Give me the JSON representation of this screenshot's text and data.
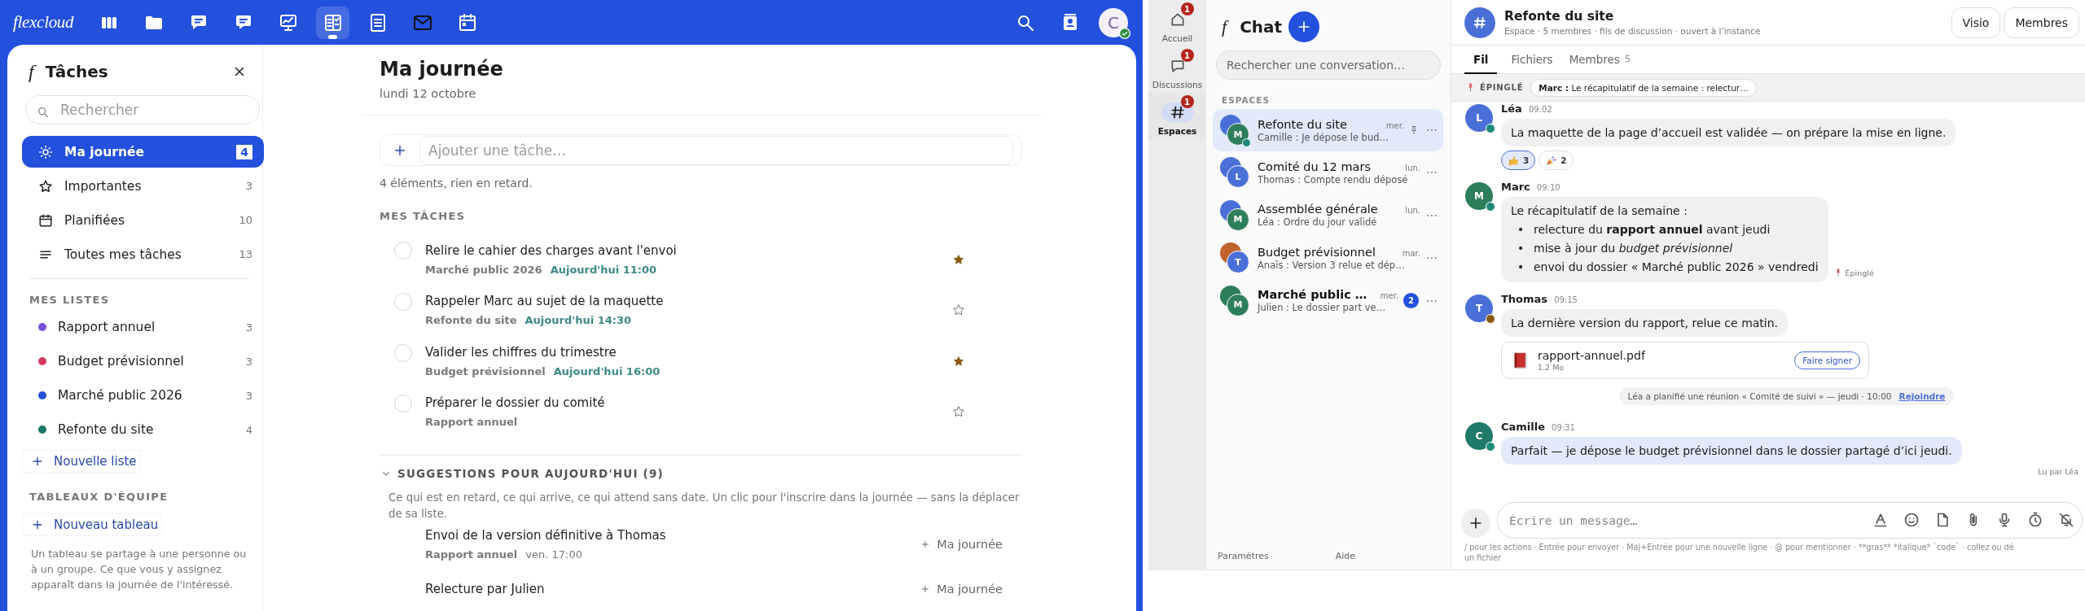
{
  "tasks_app": {
    "top_bar": {
      "logo": "flexcloud",
      "apps": [
        {
          "selected": false
        },
        {
          "selected": false
        },
        {
          "selected": false
        },
        {
          "selected": false
        },
        {
          "selected": false
        },
        {
          "selected": true
        },
        {
          "selected": false
        },
        {
          "selected": false
        },
        {
          "selected": false
        }
      ],
      "avatar": {
        "initial": "C",
        "online": true
      }
    },
    "sidebar": {
      "mark": "f",
      "title": "Tâches",
      "search_placeholder": "Rechercher",
      "views": [
        {
          "kind": "sun",
          "label": "Ma journée",
          "count": "4",
          "selected": true
        },
        {
          "kind": "star",
          "label": "Importantes",
          "count": "3",
          "selected": false
        },
        {
          "kind": "calendar",
          "label": "Planifiées",
          "count": "10",
          "selected": false
        },
        {
          "kind": "list",
          "label": "Toutes mes tâches",
          "count": "13",
          "selected": false
        }
      ],
      "lists_heading": "MES LISTES",
      "lists": [
        {
          "label": "Rapport annuel",
          "count": "3",
          "color": "#7b4fd9"
        },
        {
          "label": "Budget prévisionnel",
          "count": "3",
          "color": "#d6395e"
        },
        {
          "label": "Marché public 2026",
          "count": "3",
          "color": "#2350dd"
        },
        {
          "label": "Refonte du site",
          "count": "4",
          "color": "#1b7a6a"
        }
      ],
      "new_list": "Nouvelle liste",
      "boards_heading": "TABLEAUX D'ÉQUIPE",
      "new_board": "Nouveau tableau",
      "boards_note": "Un tableau se partage à une personne ou à un groupe. Ce que vous y assignez apparaît dans la journée de l'intéressé."
    },
    "main": {
      "title": "Ma journée",
      "date": "lundi 12 octobre",
      "add_placeholder": "Ajouter une tâche…",
      "summary": "4 éléments, rien en retard.",
      "section": "MES TÂCHES",
      "tasks": [
        {
          "title": "Relire le cahier des charges avant l'envoi",
          "list": "Marché public 2026",
          "due": "Aujourd'hui 11:00",
          "starred": true,
          "done": false
        },
        {
          "title": "Rappeler Marc au sujet de la maquette",
          "list": "Refonte du site",
          "due": "Aujourd'hui 14:30",
          "starred": false,
          "done": false
        },
        {
          "title": "Valider les chiffres du trimestre",
          "list": "Budget prévisionnel",
          "due": "Aujourd'hui 16:00",
          "starred": true,
          "done": false
        },
        {
          "title": "Préparer le dossier du comité",
          "list": "Rapport annuel",
          "starred": false,
          "done": false
        }
      ],
      "suggestions": {
        "heading": "SUGGESTIONS POUR AUJOURD'HUI (9)",
        "expanded": true,
        "description": "Ce qui est en retard, ce qui arrive, ce qui attend sans date. Un clic pour l'inscrire dans la journée — sans la déplacer de sa liste.",
        "items": [
          {
            "title": "Envoi de la version définitive à Thomas",
            "list": "Rapport annuel",
            "due": "ven. 17:00",
            "action": "Ma journée"
          },
          {
            "title": "Relecture par Julien",
            "action": "Ma journée"
          }
        ]
      }
    }
  },
  "chat_app": {
    "rail": [
      {
        "kind": "home",
        "label": "Accueil",
        "badge": "1",
        "selected": false
      },
      {
        "kind": "discussions",
        "label": "Discussions",
        "badge": "1",
        "selected": false
      },
      {
        "kind": "spaces",
        "label": "Espaces",
        "badge": "1",
        "selected": true
      }
    ],
    "list_panel": {
      "mark": "f",
      "title": "Chat",
      "search_placeholder": "Rechercher une conversation…",
      "section": "ESPACES",
      "conversations": [
        {
          "name": "Refonte du site",
          "time": "mer.",
          "preview": "Camille : Je dépose le bud…",
          "avatars": [
            {
              "color": "#4a70d8"
            },
            {
              "initial": "M",
              "color": "#2e7d5b"
            }
          ],
          "online": true,
          "pinned": true,
          "selected": true,
          "unread": false
        },
        {
          "name": "Comité du 12 mars",
          "time": "lun.",
          "preview": "Thomas : Compte rendu déposé",
          "avatars": [
            {
              "color": "#4a70d8"
            },
            {
              "initial": "L",
              "color": "#4a70d8"
            }
          ],
          "online": false,
          "pinned": false,
          "selected": false,
          "unread": false
        },
        {
          "name": "Assemblée générale",
          "time": "lun.",
          "preview": "Léa : Ordre du jour validé",
          "avatars": [
            {
              "color": "#4a70d8"
            },
            {
              "initial": "M",
              "color": "#2e7d5b"
            }
          ],
          "online": false,
          "pinned": false,
          "selected": false,
          "unread": false
        },
        {
          "name": "Budget prévisionnel",
          "time": "mar.",
          "preview": "Anaïs : Version 3 relue et dép…",
          "avatars": [
            {
              "color": "#c0622e"
            },
            {
              "initial": "T",
              "color": "#4a70d8"
            }
          ],
          "online": false,
          "pinned": false,
          "selected": false,
          "unread": false
        },
        {
          "name": "Marché public …",
          "time": "mer.",
          "preview": "Julien : Le dossier part ve…",
          "avatars": [
            {
              "color": "#2e7d5b"
            },
            {
              "initial": "M",
              "color": "#2e7d5b"
            }
          ],
          "online": false,
          "pinned": false,
          "selected": false,
          "unread": true,
          "unread_count": "2"
        }
      ],
      "footer_links": [
        "Paramètres",
        "Aide"
      ]
    },
    "conversation": {
      "title": "Refonte du site",
      "subtitle": "Espace · 5 membres · fils de discussion · ouvert à l’instance",
      "buttons": [
        "Visio",
        "Membres"
      ],
      "tabs": [
        {
          "label": "Fil",
          "selected": true
        },
        {
          "label": "Fichiers",
          "selected": false
        },
        {
          "label": "Membres",
          "count": "5",
          "selected": false
        }
      ],
      "pinned_bar": {
        "label": "ÉPINGLÉ",
        "text": "**Marc :** Le récapitulatif de la semaine : relectur…"
      },
      "timeline": [
        {
          "kind": "message",
          "author": "Léa",
          "time": "09:02",
          "initial": "L",
          "color": "#4a70d8",
          "presence": {
            "color": "#1f8a7a"
          },
          "own": false,
          "text": "La maquette de la page d’accueil est validée — on prépare la mise en ligne.",
          "reactions": [
            {
              "kind": "thumbs_up",
              "count": "3",
              "selected": true
            },
            {
              "kind": "party",
              "count": "2",
              "selected": false
            }
          ]
        },
        {
          "kind": "message",
          "author": "Marc",
          "time": "09:10",
          "initial": "M",
          "color": "#2e7d5b",
          "presence": {
            "color": "#1f8a7a"
          },
          "own": false,
          "text": "Le récapitulatif de la semaine :",
          "bullet_mark": "•",
          "bullets": [
            "relecture du **rapport annuel** avant jeudi",
            "mise à jour du *budget prévisionnel*",
            "envoi du dossier « Marché public 2026 » vendredi"
          ],
          "pinned_note": "Épinglé"
        },
        {
          "kind": "message",
          "author": "Thomas",
          "time": "09:15",
          "initial": "T",
          "color": "#4a70d8",
          "presence": {
            "color": "#8a5a12"
          },
          "own": false,
          "text": "La dernière version du rapport, relue ce matin.",
          "attachment": {
            "name": "rapport-annuel.pdf",
            "size": "1.2 Mo",
            "action": "Faire signer"
          }
        },
        {
          "kind": "event",
          "text": "Léa a planifié une réunion « Comité de suivi » — jeudi · 10:00",
          "link": "Rejoindre"
        },
        {
          "kind": "message",
          "author": "Camille",
          "time": "09:31",
          "initial": "C",
          "color": "#1f7a6a",
          "presence": {
            "color": "#1f8a7a"
          },
          "own": true,
          "text": "Parfait — je dépose le budget prévisionnel dans le dossier partagé d’ici jeudi.",
          "read_receipt": "Lu par Léa"
        }
      ],
      "composer": {
        "placeholder": "Écrire un message…",
        "hint": "/ pour les actions · Entrée pour envoyer · Maj+Entrée pour une nouvelle ligne · @ pour mentionner · **gras** *italique* `code` · collez ou dé",
        "hint_continued": "un fichier"
      }
    }
  }
}
